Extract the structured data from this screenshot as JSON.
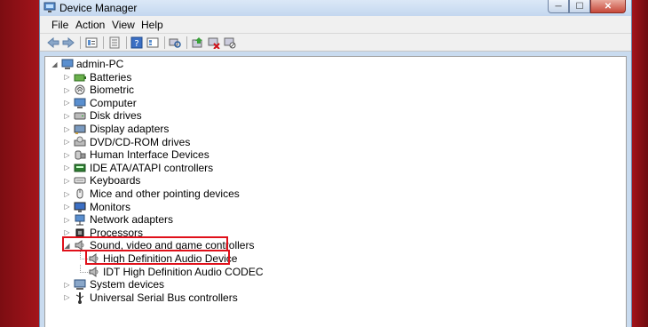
{
  "window": {
    "title": "Device Manager",
    "controls": {
      "minimize": "─",
      "maximize": "☐",
      "close": "✕"
    }
  },
  "menu": [
    "File",
    "Action",
    "View",
    "Help"
  ],
  "toolbar_icons": [
    "back-icon",
    "forward-icon",
    "properties-icon",
    "show-hide-icon",
    "help-icon",
    "view-icon",
    "scan-hardware-icon",
    "update-driver-icon",
    "uninstall-icon",
    "disable-icon"
  ],
  "tree": {
    "root": "admin-PC",
    "categories": [
      {
        "label": "Batteries",
        "icon": "battery-icon"
      },
      {
        "label": "Biometric",
        "icon": "biometric-icon"
      },
      {
        "label": "Computer",
        "icon": "computer-icon"
      },
      {
        "label": "Disk drives",
        "icon": "disk-drive-icon"
      },
      {
        "label": "Display adapters",
        "icon": "display-adapter-icon"
      },
      {
        "label": "DVD/CD-ROM drives",
        "icon": "dvd-drive-icon"
      },
      {
        "label": "Human Interface Devices",
        "icon": "hid-icon"
      },
      {
        "label": "IDE ATA/ATAPI controllers",
        "icon": "ide-controller-icon"
      },
      {
        "label": "Keyboards",
        "icon": "keyboard-icon"
      },
      {
        "label": "Mice and other pointing devices",
        "icon": "mouse-icon"
      },
      {
        "label": "Monitors",
        "icon": "monitor-icon"
      },
      {
        "label": "Network adapters",
        "icon": "network-adapter-icon"
      },
      {
        "label": "Processors",
        "icon": "processor-icon"
      },
      {
        "label": "Sound, video and game controllers",
        "icon": "speaker-icon",
        "expanded": true,
        "highlighted": true,
        "children": [
          {
            "label": "High Definition Audio Device",
            "icon": "speaker-icon",
            "highlighted": true
          },
          {
            "label": "IDT High Definition Audio CODEC",
            "icon": "speaker-icon"
          }
        ]
      },
      {
        "label": "System devices",
        "icon": "system-devices-icon"
      },
      {
        "label": "Universal Serial Bus controllers",
        "icon": "usb-icon"
      }
    ]
  },
  "highlight_color": "#e0101a"
}
